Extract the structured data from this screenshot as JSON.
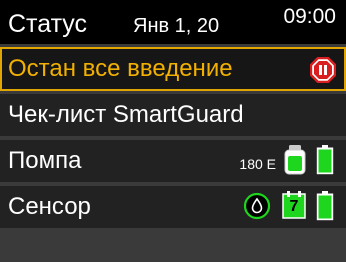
{
  "header": {
    "title": "Статус",
    "date": "Янв 1, 20",
    "time": "09:00"
  },
  "menu": {
    "stop_delivery": "Остан все введение",
    "smartguard_checklist": "Чек-лист SmartGuard",
    "pump": "Помпа",
    "sensor": "Сенсор"
  },
  "pump": {
    "reservoir_units": "180 Е",
    "reservoir_icon": "reservoir-icon",
    "battery_icon": "battery-icon"
  },
  "sensor": {
    "calibration_icon": "calendar-icon",
    "calibration_days": "7",
    "drop_icon": "blood-drop-icon",
    "battery_icon": "battery-icon"
  },
  "colors": {
    "accent": "#f2b100",
    "ok_green": "#1ed61e",
    "stop_red": "#d81e1e"
  }
}
